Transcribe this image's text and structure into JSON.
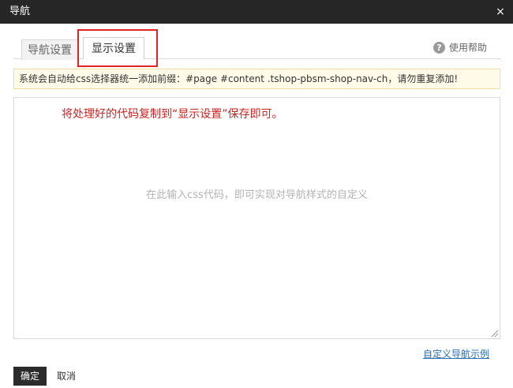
{
  "dialog": {
    "title": "导航",
    "close_glyph": "×"
  },
  "tabs": [
    {
      "label": "导航设置",
      "active": false
    },
    {
      "label": "显示设置",
      "active": true
    }
  ],
  "help": {
    "icon": "question-icon",
    "icon_glyph": "?",
    "label": "使用帮助"
  },
  "notice": {
    "text": "系统会自动给css选择器统一添加前缀：#page #content .tshop-pbsm-shop-nav-ch，请勿重复添加!"
  },
  "editor": {
    "annotation": "将处理好的代码复制到“显示设置”保存即可。",
    "placeholder": "在此输入css代码，即可实现对导航样式的自定义",
    "value": ""
  },
  "footer": {
    "example_link": "自定义导航示例",
    "confirm_label": "确定",
    "cancel_label": "取消"
  },
  "colors": {
    "title_bar": "#262626",
    "highlight": "#e02424",
    "annotation": "#cc2222",
    "notice_bg": "#fffbe8",
    "link": "#2b6cb0"
  }
}
